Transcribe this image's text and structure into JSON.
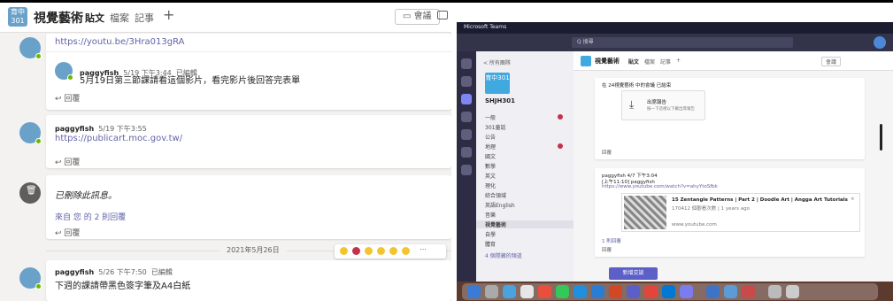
{
  "left": {
    "header": {
      "avatar_text": "育中301",
      "title": "視覺藝術",
      "tabs": [
        "貼文",
        "檔案",
        "記事"
      ],
      "plus": "+",
      "meet_label": "會議"
    },
    "messages": [
      {
        "link": "https://youtu.be/3Hra013gRA",
        "reply": {
          "author": "paggyfish",
          "time": "5/19 下午3:44",
          "edited": "已編輯",
          "text": "5月19日第三節課請看這個影片，看完影片後回答完表單"
        },
        "reply_label": "回覆"
      },
      {
        "author": "paggyfish",
        "time": "5/19 下午3:55",
        "link": "https://publicart.moc.gov.tw/",
        "reply_label": "回覆"
      },
      {
        "deleted_text": "已刪除此訊息。",
        "replies_text": "來自 您 的 2 則回覆",
        "reply_label": "回覆"
      }
    ],
    "date_divider": "2021年5月26日",
    "last_message": {
      "author": "paggyfish",
      "time": "5/26 下午7:50",
      "edited": "已編輯",
      "text": "下週的課請帶黑色簽字筆及A4白紙"
    },
    "colors": {
      "accent": "#6264a7",
      "background": "#f3f2f1",
      "card": "#ffffff"
    }
  },
  "right": {
    "topbar_title": "Microsoft Teams",
    "search_placeholder": "Q 搜尋",
    "sidebar": {
      "back": "< 所有團隊",
      "logo_text": "育中301",
      "team_name": "SHJH301",
      "channels": [
        "一般",
        "301童話",
        "公告",
        "地理",
        "國文",
        "數學",
        "英文",
        "理化",
        "綜合領域",
        "英語English",
        "音樂",
        "視覺藝術",
        "自學",
        "體育",
        "4 個隱藏的頻道"
      ],
      "selected": "視覺藝術"
    },
    "chat": {
      "header_name": "視覺藝術",
      "tabs": [
        "貼文",
        "檔案",
        "記事",
        "+"
      ],
      "meet_label": "會議",
      "post1_title": "在 24視覺藝術 中的會議 已結束",
      "file_name": "出席報告",
      "file_sub": "按一下這裡以下載出席報告",
      "reply_label": "回覆",
      "post2_author": "paggyfish 4/7 下午3:04",
      "post2_line1": "[上午11:10] paggyfish",
      "post2_link": "https://www.youtube.com/watch?v=ahyYtoSfbk",
      "preview_title": "15 Zentangle Patterns | Part 2 | Doodle Art | Angga Art Tutorials",
      "preview_meta": "170412 個觀看次數 | 1 years ago",
      "preview_site": "www.youtube.com",
      "see_more": "1 則回覆",
      "new_conversation": "新增交談"
    }
  }
}
